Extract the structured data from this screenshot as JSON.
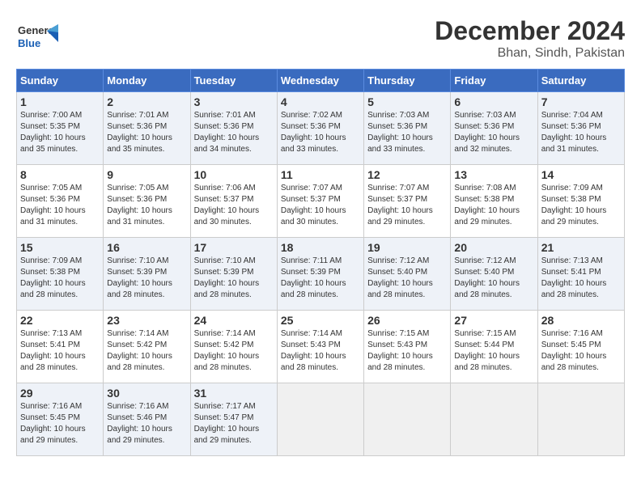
{
  "header": {
    "logo_general": "General",
    "logo_blue": "Blue",
    "main_title": "December 2024",
    "subtitle": "Bhan, Sindh, Pakistan"
  },
  "calendar": {
    "days_of_week": [
      "Sunday",
      "Monday",
      "Tuesday",
      "Wednesday",
      "Thursday",
      "Friday",
      "Saturday"
    ],
    "weeks": [
      [
        {
          "day": "",
          "info": ""
        },
        {
          "day": "2",
          "info": "Sunrise: 7:01 AM\nSunset: 5:36 PM\nDaylight: 10 hours\nand 35 minutes."
        },
        {
          "day": "3",
          "info": "Sunrise: 7:01 AM\nSunset: 5:36 PM\nDaylight: 10 hours\nand 34 minutes."
        },
        {
          "day": "4",
          "info": "Sunrise: 7:02 AM\nSunset: 5:36 PM\nDaylight: 10 hours\nand 33 minutes."
        },
        {
          "day": "5",
          "info": "Sunrise: 7:03 AM\nSunset: 5:36 PM\nDaylight: 10 hours\nand 33 minutes."
        },
        {
          "day": "6",
          "info": "Sunrise: 7:03 AM\nSunset: 5:36 PM\nDaylight: 10 hours\nand 32 minutes."
        },
        {
          "day": "7",
          "info": "Sunrise: 7:04 AM\nSunset: 5:36 PM\nDaylight: 10 hours\nand 31 minutes."
        }
      ],
      [
        {
          "day": "1",
          "info": "Sunrise: 7:00 AM\nSunset: 5:35 PM\nDaylight: 10 hours\nand 35 minutes."
        },
        {
          "day": "",
          "info": ""
        },
        {
          "day": "",
          "info": ""
        },
        {
          "day": "",
          "info": ""
        },
        {
          "day": "",
          "info": ""
        },
        {
          "day": "",
          "info": ""
        },
        {
          "day": "",
          "info": ""
        }
      ],
      [
        {
          "day": "8",
          "info": "Sunrise: 7:05 AM\nSunset: 5:36 PM\nDaylight: 10 hours\nand 31 minutes."
        },
        {
          "day": "9",
          "info": "Sunrise: 7:05 AM\nSunset: 5:36 PM\nDaylight: 10 hours\nand 31 minutes."
        },
        {
          "day": "10",
          "info": "Sunrise: 7:06 AM\nSunset: 5:37 PM\nDaylight: 10 hours\nand 30 minutes."
        },
        {
          "day": "11",
          "info": "Sunrise: 7:07 AM\nSunset: 5:37 PM\nDaylight: 10 hours\nand 30 minutes."
        },
        {
          "day": "12",
          "info": "Sunrise: 7:07 AM\nSunset: 5:37 PM\nDaylight: 10 hours\nand 29 minutes."
        },
        {
          "day": "13",
          "info": "Sunrise: 7:08 AM\nSunset: 5:38 PM\nDaylight: 10 hours\nand 29 minutes."
        },
        {
          "day": "14",
          "info": "Sunrise: 7:09 AM\nSunset: 5:38 PM\nDaylight: 10 hours\nand 29 minutes."
        }
      ],
      [
        {
          "day": "15",
          "info": "Sunrise: 7:09 AM\nSunset: 5:38 PM\nDaylight: 10 hours\nand 28 minutes."
        },
        {
          "day": "16",
          "info": "Sunrise: 7:10 AM\nSunset: 5:39 PM\nDaylight: 10 hours\nand 28 minutes."
        },
        {
          "day": "17",
          "info": "Sunrise: 7:10 AM\nSunset: 5:39 PM\nDaylight: 10 hours\nand 28 minutes."
        },
        {
          "day": "18",
          "info": "Sunrise: 7:11 AM\nSunset: 5:39 PM\nDaylight: 10 hours\nand 28 minutes."
        },
        {
          "day": "19",
          "info": "Sunrise: 7:12 AM\nSunset: 5:40 PM\nDaylight: 10 hours\nand 28 minutes."
        },
        {
          "day": "20",
          "info": "Sunrise: 7:12 AM\nSunset: 5:40 PM\nDaylight: 10 hours\nand 28 minutes."
        },
        {
          "day": "21",
          "info": "Sunrise: 7:13 AM\nSunset: 5:41 PM\nDaylight: 10 hours\nand 28 minutes."
        }
      ],
      [
        {
          "day": "22",
          "info": "Sunrise: 7:13 AM\nSunset: 5:41 PM\nDaylight: 10 hours\nand 28 minutes."
        },
        {
          "day": "23",
          "info": "Sunrise: 7:14 AM\nSunset: 5:42 PM\nDaylight: 10 hours\nand 28 minutes."
        },
        {
          "day": "24",
          "info": "Sunrise: 7:14 AM\nSunset: 5:42 PM\nDaylight: 10 hours\nand 28 minutes."
        },
        {
          "day": "25",
          "info": "Sunrise: 7:14 AM\nSunset: 5:43 PM\nDaylight: 10 hours\nand 28 minutes."
        },
        {
          "day": "26",
          "info": "Sunrise: 7:15 AM\nSunset: 5:43 PM\nDaylight: 10 hours\nand 28 minutes."
        },
        {
          "day": "27",
          "info": "Sunrise: 7:15 AM\nSunset: 5:44 PM\nDaylight: 10 hours\nand 28 minutes."
        },
        {
          "day": "28",
          "info": "Sunrise: 7:16 AM\nSunset: 5:45 PM\nDaylight: 10 hours\nand 28 minutes."
        }
      ],
      [
        {
          "day": "29",
          "info": "Sunrise: 7:16 AM\nSunset: 5:45 PM\nDaylight: 10 hours\nand 29 minutes."
        },
        {
          "day": "30",
          "info": "Sunrise: 7:16 AM\nSunset: 5:46 PM\nDaylight: 10 hours\nand 29 minutes."
        },
        {
          "day": "31",
          "info": "Sunrise: 7:17 AM\nSunset: 5:47 PM\nDaylight: 10 hours\nand 29 minutes."
        },
        {
          "day": "",
          "info": ""
        },
        {
          "day": "",
          "info": ""
        },
        {
          "day": "",
          "info": ""
        },
        {
          "day": "",
          "info": ""
        }
      ]
    ]
  }
}
